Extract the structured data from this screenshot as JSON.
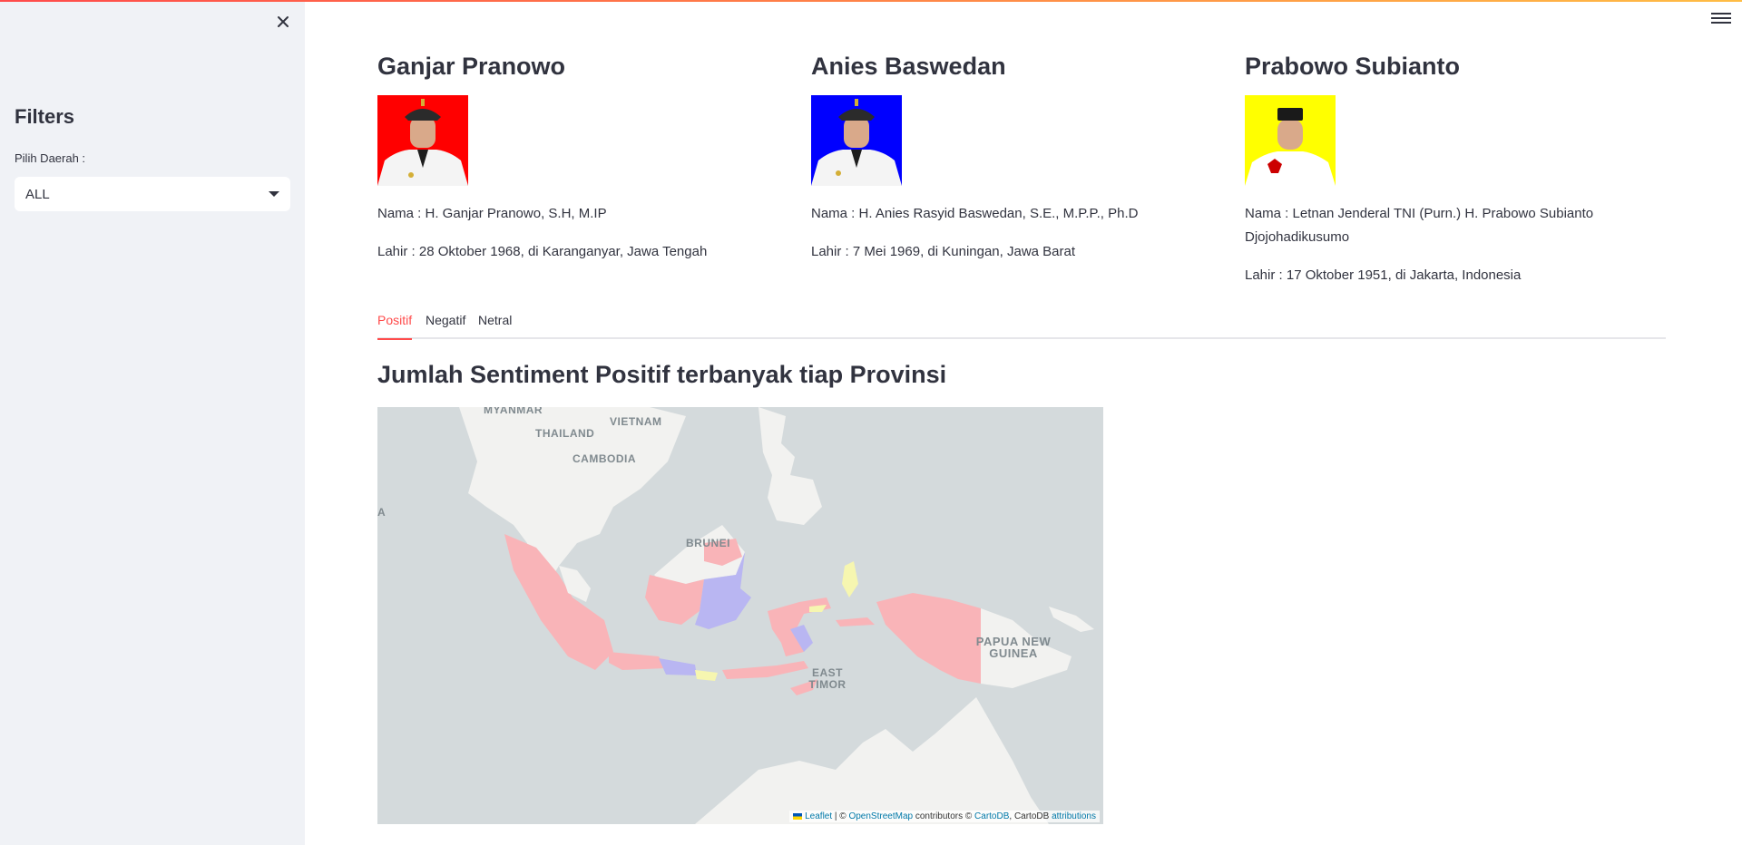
{
  "sidebar": {
    "close_icon": "close-icon",
    "title": "Filters",
    "region_label": "Pilih Daerah :",
    "region_value": "ALL"
  },
  "menu_icon": "hamburger-menu-icon",
  "candidates": [
    {
      "name": "Ganjar Pranowo",
      "photo_bg": "#ff0000",
      "full_name": "Nama : H. Ganjar Pranowo, S.H, M.IP",
      "birth": "Lahir : 28 Oktober 1968, di Karanganyar, Jawa Tengah"
    },
    {
      "name": "Anies Baswedan",
      "photo_bg": "#0000ff",
      "full_name": "Nama : H. Anies Rasyid Baswedan, S.E., M.P.P., Ph.D",
      "birth": "Lahir : 7 Mei 1969, di Kuningan, Jawa Barat"
    },
    {
      "name": "Prabowo Subianto",
      "photo_bg": "#ffff00",
      "full_name": "Nama : Letnan Jenderal TNI (Purn.) H. Prabowo Subianto Djojohadikusumo",
      "birth": "Lahir : 17 Oktober 1951, di Jakarta, Indonesia"
    }
  ],
  "tabs": [
    {
      "label": "Positif",
      "active": true
    },
    {
      "label": "Negatif",
      "active": false
    },
    {
      "label": "Netral",
      "active": false
    }
  ],
  "section_title": "Jumlah Sentiment Positif terbanyak tiap Provinsi",
  "map": {
    "labels": {
      "myanmar": "MYANMAR",
      "thailand": "THAILAND",
      "vietnam": "VIETNAM",
      "cambodia": "CAMBODIA",
      "brunei": "BRUNEI",
      "east_timor": "EAST TIMOR",
      "png": "PAPUA NEW GUINEA",
      "edge": "A"
    },
    "attribution": {
      "leaflet": "Leaflet",
      "sep1": " | © ",
      "osm": "OpenStreetMap",
      "contrib": " contributors © ",
      "cartodb": "CartoDB",
      "cartodb2": ", CartoDB ",
      "attributions": "attributions"
    },
    "colors": {
      "ganjar": "#f9b4b8",
      "anies": "#b9b6f2",
      "prabowo": "#f6f6b0",
      "land": "#f2f2f0",
      "sea": "#d4dadc"
    }
  }
}
